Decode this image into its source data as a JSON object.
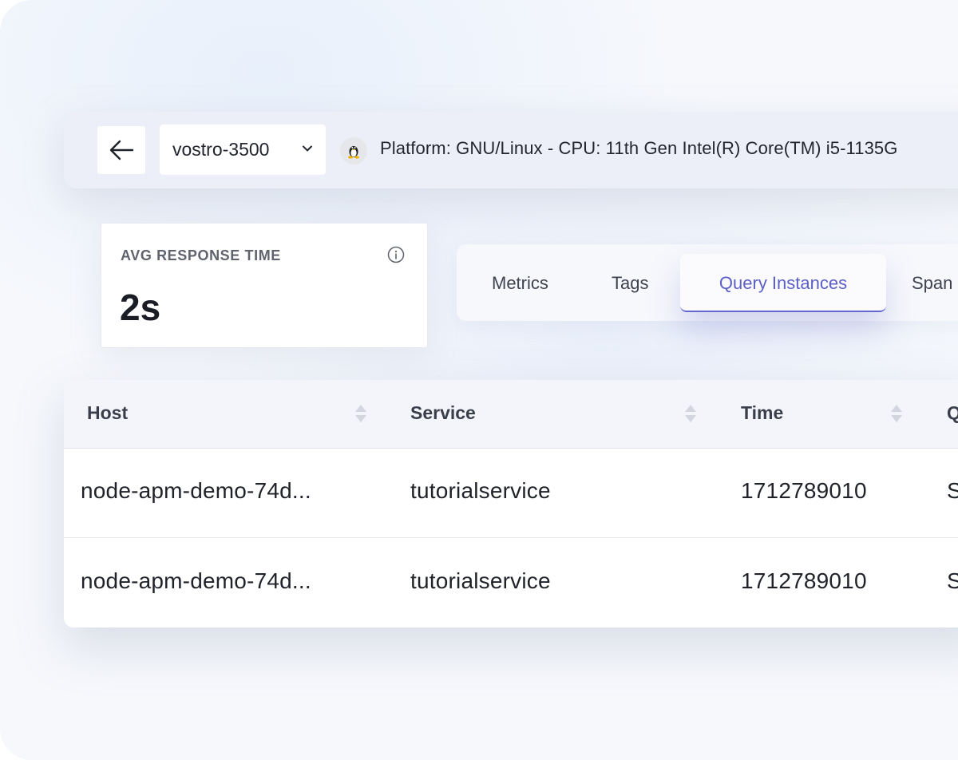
{
  "topbar": {
    "host": "vostro-3500",
    "platform_text": "Platform: GNU/Linux - CPU: 11th Gen Intel(R) Core(TM) i5-1135G",
    "icons": [
      "back-arrow-icon",
      "chevron-down-icon",
      "linux-penguin-icon"
    ]
  },
  "stat": {
    "label": "AVG RESPONSE TIME",
    "value": "2s"
  },
  "tabs": [
    {
      "label": "Metrics"
    },
    {
      "label": "Tags"
    },
    {
      "label": "Query Instances",
      "active": true
    },
    {
      "label": "Span"
    }
  ],
  "table": {
    "columns": [
      "Host",
      "Service",
      "Time",
      "Q"
    ],
    "rows": [
      {
        "host": "node-apm-demo-74d...",
        "service": "tutorialservice",
        "time": "1712789010",
        "q": "S"
      },
      {
        "host": "node-apm-demo-74d...",
        "service": "tutorialservice",
        "time": "1712789010",
        "q": "S"
      }
    ]
  },
  "colors": {
    "accent": "#5b5fc7",
    "text": "#1f2229",
    "muted": "#5f636d",
    "background": "#f6f8fc"
  }
}
